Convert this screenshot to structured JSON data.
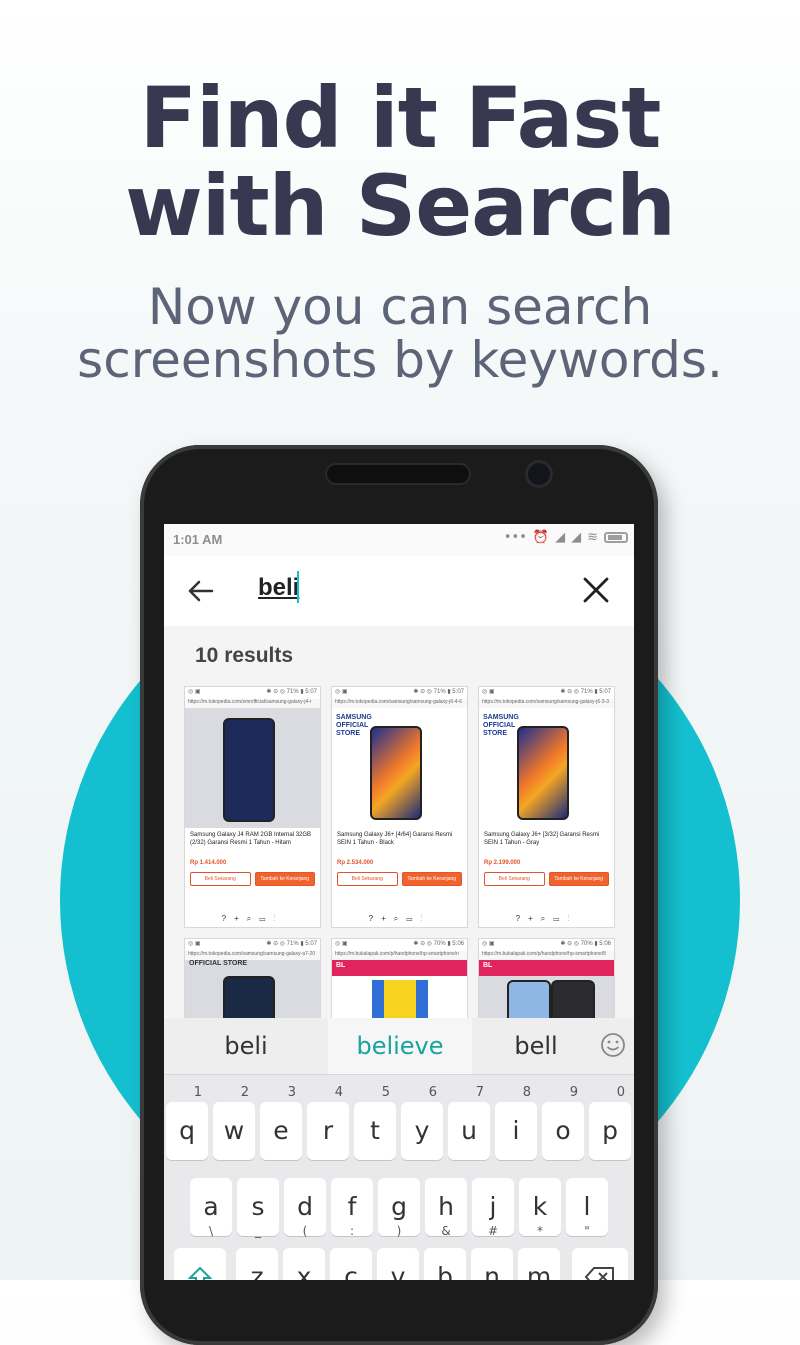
{
  "promo": {
    "headline_line1": "Find it Fast",
    "headline_line2": "with Search",
    "subtitle_line1": "Now you can search",
    "subtitle_line2": "screenshots by keywords."
  },
  "status_bar": {
    "time": "1:01 AM",
    "icons": [
      "more-icon",
      "alarm-icon",
      "signal-icon",
      "signal-icon",
      "wifi-icon",
      "battery-icon"
    ]
  },
  "search": {
    "query": "beli",
    "back_icon": "back-arrow-icon",
    "clear_icon": "close-icon"
  },
  "results": {
    "count_label": "10 results",
    "items": [
      {
        "status_left": "◎ ▣",
        "status_right": "✱ ⊝ ◎ 71% ▮ 5:07",
        "url": "https://m.tokopedia.com/smrofficial/samsung-galaxy-j4-r",
        "title": "Samsung Galaxy J4 RAM 2GB Internal 32GB (2/32) Garansi Resmi 1 Tahun - Hitam",
        "price": "Rp 1.414.000",
        "btn1": "Beli Sekarang",
        "btn2": "Tambah ke Keranjang"
      },
      {
        "status_left": "◎ ▣",
        "status_right": "✱ ⊝ ◎ 71% ▮ 5:07",
        "url": "https://m.tokopedia.com/samsung/samsung-galaxy-j6-4-6",
        "brand": "SAMSUNG OFFICIAL STORE",
        "title": "Samsung Galaxy J6+ [4/64] Garansi Resmi SEIN 1 Tahun - Black",
        "price": "Rp 2.534.000",
        "btn1": "Beli Sekarang",
        "btn2": "Tambah ke Keranjang"
      },
      {
        "status_left": "◎ ▣",
        "status_right": "✱ ⊝ ◎ 71% ▮ 5:07",
        "url": "https://m.tokopedia.com/samsung/samsung-galaxy-j6-3-3",
        "brand": "SAMSUNG OFFICIAL STORE",
        "title": "Samsung Galaxy J6+ [3/32] Garansi Resmi SEIN 1 Tahun - Gray",
        "price": "Rp 2.199.000",
        "btn1": "Beli Sekarang",
        "btn2": "Tambah ke Keranjang"
      },
      {
        "status_left": "◎ ▣",
        "status_right": "✱ ⊝ ◎ 71% ▮ 5:07",
        "url": "https://m.tokopedia.com/samsung/samsung-galaxy-a7-20",
        "brand": "OFFICIAL STORE"
      },
      {
        "status_left": "◎ ▣",
        "status_right": "✱ ⊝ ◎ 70% ▮ 5:06",
        "url": "https://m.bukalapak.com/p/handphone/hp-smartphone/n",
        "brand": "BL"
      },
      {
        "status_left": "◎ ▣",
        "status_right": "✱ ⊝ ◎ 70% ▮ 5:06",
        "url": "https://m.bukalapak.com/p/handphone/hp-smartphone/8",
        "brand": "BL"
      }
    ]
  },
  "keyboard": {
    "suggestions": [
      "beli",
      "believe",
      "bell"
    ],
    "row1": [
      {
        "k": "q",
        "h": "1"
      },
      {
        "k": "w",
        "h": "2"
      },
      {
        "k": "e",
        "h": "3"
      },
      {
        "k": "r",
        "h": "4"
      },
      {
        "k": "t",
        "h": "5"
      },
      {
        "k": "y",
        "h": "6"
      },
      {
        "k": "u",
        "h": "7"
      },
      {
        "k": "i",
        "h": "8"
      },
      {
        "k": "o",
        "h": "9"
      },
      {
        "k": "p",
        "h": "0"
      }
    ],
    "row2": [
      {
        "k": "a",
        "h": "\\"
      },
      {
        "k": "s",
        "h": "_"
      },
      {
        "k": "d",
        "h": "("
      },
      {
        "k": "f",
        "h": ":"
      },
      {
        "k": "g",
        "h": ")"
      },
      {
        "k": "h",
        "h": "&"
      },
      {
        "k": "j",
        "h": "#"
      },
      {
        "k": "k",
        "h": "*"
      },
      {
        "k": "l",
        "h": "\""
      }
    ],
    "row3": [
      {
        "k": "z",
        "h": "@"
      },
      {
        "k": "x",
        "h": "-"
      },
      {
        "k": "c",
        "h": "-"
      },
      {
        "k": "v",
        "h": "'"
      },
      {
        "k": "b",
        "h": "!"
      },
      {
        "k": "n",
        "h": "?"
      },
      {
        "k": "m",
        "h": "/"
      }
    ]
  }
}
